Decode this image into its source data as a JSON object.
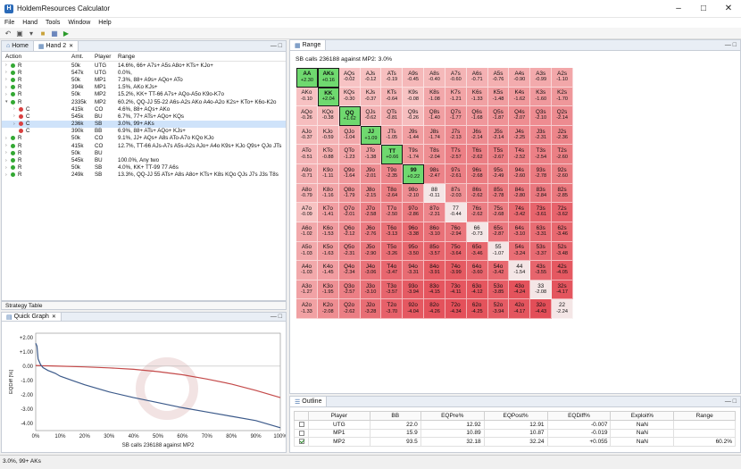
{
  "window": {
    "title": "HoldemResources Calculator"
  },
  "menu": [
    "File",
    "Hand",
    "Tools",
    "Window",
    "Help"
  ],
  "left_tabs": {
    "home": "Home",
    "hand": "Hand 2"
  },
  "hand_table": {
    "headers": {
      "action": "Action",
      "amt": "Amt.",
      "player": "Player",
      "range": "Range"
    },
    "rows": [
      {
        "indent": 0,
        "tri": ">",
        "dot": "#33a833",
        "act": "R",
        "amt": "50k",
        "player": "UTG",
        "range": "14.6%, 66+ A7s+ A5s A8o+ KTs+ KJo+",
        "sel": false
      },
      {
        "indent": 0,
        "tri": ">",
        "dot": "#33a833",
        "act": "R",
        "amt": "547k",
        "player": "UTG",
        "range": "0.0%,",
        "sel": false
      },
      {
        "indent": 0,
        "tri": ">",
        "dot": "#33a833",
        "act": "R",
        "amt": "50k",
        "player": "MP1",
        "range": "7.3%, 88+ A9s+ AQo+ ATo",
        "sel": false
      },
      {
        "indent": 0,
        "tri": ">",
        "dot": "#33a833",
        "act": "R",
        "amt": "394k",
        "player": "MP1",
        "range": "1.5%, AKo KJs+",
        "sel": false
      },
      {
        "indent": 0,
        "tri": ">",
        "dot": "#33a833",
        "act": "R",
        "amt": "50k",
        "player": "MP2",
        "range": "15.2%, KK+ TT-66 A7s+ AQo-A5o K9o-K7o",
        "sel": false
      },
      {
        "indent": 0,
        "tri": "v",
        "dot": "#33a833",
        "act": "R",
        "amt": "2335k",
        "player": "MP2",
        "range": "60.2%, QQ-JJ 55-22 A6s-A2s AKo A4o-A2o K2s+ KTo+ K6o-K2o",
        "sel": false
      },
      {
        "indent": 1,
        "tri": ">",
        "dot": "#d94040",
        "act": "C",
        "amt": "415k",
        "player": "CO",
        "range": "4.6%, 88+ AQs+ AKo",
        "sel": false
      },
      {
        "indent": 1,
        "tri": ">",
        "dot": "#d94040",
        "act": "C",
        "amt": "545k",
        "player": "BU",
        "range": "6.7%, 77+ ATs+ AQo+ KQs",
        "sel": false
      },
      {
        "indent": 1,
        "tri": ">",
        "dot": "#d94040",
        "act": "C",
        "amt": "236k",
        "player": "SB",
        "range": "3.0%, 99+ AKs",
        "sel": true
      },
      {
        "indent": 1,
        "tri": "",
        "dot": "#d94040",
        "act": "C",
        "amt": "390k",
        "player": "BB",
        "range": "6.9%, 88+ ATs+ AQo+ KJs+",
        "sel": false
      },
      {
        "indent": 0,
        "tri": ">",
        "dot": "#33a833",
        "act": "R",
        "amt": "50k",
        "player": "CO",
        "range": "9.1%, JJ+ AQs+ A8s ATo-A7o KQo KJo",
        "sel": false
      },
      {
        "indent": 0,
        "tri": ">",
        "dot": "#33a833",
        "act": "R",
        "amt": "415k",
        "player": "CO",
        "range": "12.7%, TT-66 AJs-A7s A5s-A2s AJo+ A4o K9s+ KJo Q9s+ QJo JTs",
        "sel": false
      },
      {
        "indent": 0,
        "tri": ">",
        "dot": "#33a833",
        "act": "R",
        "amt": "50k",
        "player": "BU",
        "range": "",
        "sel": false
      },
      {
        "indent": 0,
        "tri": ">",
        "dot": "#33a833",
        "act": "R",
        "amt": "545k",
        "player": "BU",
        "range": "100.0%, Any two",
        "sel": false
      },
      {
        "indent": 0,
        "tri": ">",
        "dot": "#33a833",
        "act": "R",
        "amt": "50k",
        "player": "SB",
        "range": "4.0%, KK+ TT-99 77 A6s",
        "sel": false
      },
      {
        "indent": 0,
        "tri": ">",
        "dot": "#33a833",
        "act": "R",
        "amt": "249k",
        "player": "SB",
        "range": "13.3%, QQ-JJ 55 ATs+ A8s A8o+ KTs+ K8s KQo QJs J7s J3s T8s",
        "sel": false
      }
    ]
  },
  "strategy_table_label": "Strategy Table",
  "quick_graph": {
    "tab": "Quick Graph",
    "ylabel": "EQDiff [%]",
    "xlabel": "SB calls 236188 against MP2",
    "yticks": [
      "+2.00",
      "+1.00",
      "0.00",
      "-1.00",
      "-2.00",
      "-3.00",
      "-4.00"
    ],
    "xticks": [
      "0%",
      "10%",
      "20%",
      "30%",
      "40%",
      "50%",
      "60%",
      "70%",
      "80%",
      "90%",
      "100%"
    ]
  },
  "chart_data": {
    "type": "line",
    "xlabel": "SB calls 236188 against MP2",
    "ylabel": "EQDiff [%]",
    "xlim": [
      0,
      100
    ],
    "ylim": [
      -4.5,
      2.3
    ],
    "series": [
      {
        "color": "#c44a4a",
        "x": [
          0,
          2,
          5,
          10,
          20,
          30,
          40,
          50,
          60,
          70,
          80,
          90,
          100
        ],
        "y": [
          0.05,
          0.03,
          0.02,
          0.0,
          -0.05,
          -0.12,
          -0.22,
          -0.38,
          -0.6,
          -0.9,
          -1.25,
          -1.7,
          -2.2
        ]
      },
      {
        "color": "#3c5a8a",
        "x": [
          0,
          0.5,
          1,
          2,
          3,
          5,
          8,
          10,
          15,
          20,
          30,
          40,
          50,
          60,
          70,
          80,
          90,
          100
        ],
        "y": [
          1.6,
          1.4,
          0.5,
          0.1,
          -0.1,
          -0.3,
          -0.5,
          -0.7,
          -1.0,
          -1.3,
          -1.8,
          -2.2,
          -2.55,
          -2.9,
          -3.2,
          -3.5,
          -3.8,
          -4.3
        ]
      }
    ]
  },
  "range_panel": {
    "tab": "Range",
    "title": "SB calls 236188 against MP2: 3.0%",
    "ranks": [
      "A",
      "K",
      "Q",
      "J",
      "T",
      "9",
      "8",
      "7",
      "6",
      "5",
      "4",
      "3",
      "2"
    ],
    "values": [
      [
        "+2.30",
        "+0.16",
        "-0.02",
        "-0.12",
        "-0.19",
        "-0.45",
        "-0.40",
        "-0.60",
        "-0.71",
        "-0.76",
        "-0.90",
        "-0.99",
        "-1.10"
      ],
      [
        "-0.10",
        "+2.04",
        "-0.30",
        "-0.37",
        "-0.64",
        "-0.08",
        "-1.08",
        "-1.21",
        "-1.33",
        "-1.48",
        "-1.62",
        "-1.60",
        "-1.70"
      ],
      [
        "-0.26",
        "-0.38",
        "+1.62",
        "-0.62",
        "-0.81",
        "-0.26",
        "-1.40",
        "-1.77",
        "-1.68",
        "-1.87",
        "-2.07",
        "-2.10",
        "-2.14"
      ],
      [
        "-0.37",
        "-0.59",
        "-1.04",
        "+1.09",
        "-1.05",
        "-1.44",
        "-1.74",
        "-2.13",
        "-2.14",
        "-2.14",
        "-2.25",
        "-2.31",
        "-2.36"
      ],
      [
        "-0.51",
        "-0.88",
        "-1.23",
        "-1.38",
        "+0.66",
        "-1.74",
        "-2.04",
        "-2.57",
        "-2.62",
        "-2.67",
        "-2.52",
        "-2.54",
        "-2.60"
      ],
      [
        "-0.71",
        "-1.11",
        "-1.64",
        "-2.01",
        "-2.35",
        "+0.22",
        "-2.47",
        "-2.61",
        "-2.68",
        "-2.49",
        "-2.60",
        "-2.78",
        "-2.60"
      ],
      [
        "-0.79",
        "-1.16",
        "-1.79",
        "-2.15",
        "-2.64",
        "-2.10",
        "-0.11",
        "-2.03",
        "-2.62",
        "-2.78",
        "-2.80",
        "-2.84",
        "-2.85"
      ],
      [
        "-0.09",
        "-1.41",
        "-2.01",
        "-2.58",
        "-2.50",
        "-2.86",
        "-2.31",
        "-0.44",
        "-2.62",
        "-2.68",
        "-3.42",
        "-3.61",
        "-3.62"
      ],
      [
        "-1.02",
        "-1.53",
        "-2.12",
        "-2.76",
        "-3.13",
        "-3.38",
        "-3.10",
        "-2.94",
        "-0.73",
        "-2.87",
        "-3.10",
        "-3.31",
        "-3.46"
      ],
      [
        "-1.03",
        "-1.63",
        "-2.31",
        "-2.90",
        "-3.26",
        "-3.50",
        "-3.57",
        "-3.64",
        "-3.46",
        "-1.07",
        "-3.24",
        "-3.37",
        "-3.48"
      ],
      [
        "-1.03",
        "-1.45",
        "-2.34",
        "-3.06",
        "-3.47",
        "-3.31",
        "-3.91",
        "-3.99",
        "-3.60",
        "-3.42",
        "-1.54",
        "-3.55",
        "-4.05"
      ],
      [
        "-1.27",
        "-1.95",
        "-2.57",
        "-3.10",
        "-3.57",
        "-3.94",
        "-4.15",
        "-4.11",
        "-4.12",
        "-3.85",
        "-4.24",
        "-2.08",
        "-4.17"
      ],
      [
        "-1.33",
        "-2.08",
        "-2.62",
        "-3.28",
        "-3.70",
        "-4.04",
        "-4.26",
        "-4.34",
        "-4.25",
        "-3.94",
        "-4.17",
        "-4.43",
        "-2.24"
      ]
    ]
  },
  "outline": {
    "tab": "Outline",
    "headers": [
      "",
      "Player",
      "BB",
      "EQPre%",
      "EQPost%",
      "EQDiff%",
      "Exploit%",
      "Range"
    ],
    "rows": [
      {
        "checked": false,
        "player": "UTG",
        "bb": "22.0",
        "eqpre": "12.92",
        "eqpost": "12.91",
        "eqdiff": "-0.007",
        "exploit": "NaN",
        "range": ""
      },
      {
        "checked": false,
        "player": "MP1",
        "bb": "15.9",
        "eqpre": "10.89",
        "eqpost": "10.87",
        "eqdiff": "-0.019",
        "exploit": "NaN",
        "range": ""
      },
      {
        "checked": true,
        "player": "MP2",
        "bb": "93.5",
        "eqpre": "32.18",
        "eqpost": "32.24",
        "eqdiff": "+0.055",
        "exploit": "NaN",
        "range": "60.2%"
      }
    ]
  },
  "status": "3.0%, 99+ AKs"
}
